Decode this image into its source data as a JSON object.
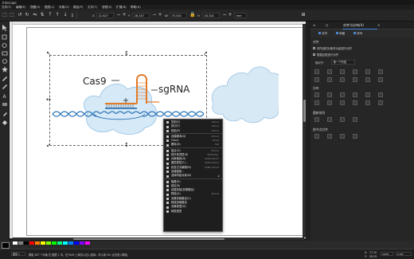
{
  "app": {
    "title": "Inkscape"
  },
  "menubar": [
    "文件(F)",
    "编辑(E)",
    "视图(V)",
    "图层(L)",
    "对象(O)",
    "路径(P)",
    "文字(T)",
    "滤镜(S)",
    "扩展(N)",
    "帮助(H)"
  ],
  "toolbar": {
    "x_label": "X",
    "x_value": "21.627",
    "y_label": "Y",
    "y_value": "26.337",
    "w_label": "W",
    "w_value": "75.001",
    "h_label": "H",
    "h_value": "43.301",
    "unit": "mm"
  },
  "drawing": {
    "cas9_label": "Cas9",
    "sgrna_label": "sgRNA"
  },
  "context_menu": [
    {
      "label": "复制(C)",
      "shortcut": "Ctrl+C"
    },
    {
      "label": "剪切(T)",
      "shortcut": "Ctrl+X"
    },
    {
      "label": "粘贴(P)",
      "shortcut": "Ctrl+V"
    },
    {
      "sep": true
    },
    {
      "label": "创建副本(D)",
      "shortcut": "Ctrl+D"
    },
    {
      "label": "Clone",
      "shortcut": "Alt+D"
    },
    {
      "label": "删除(D)",
      "shortcut": "Del"
    },
    {
      "sep": true
    },
    {
      "label": "组合(G)",
      "shortcut": "Ctrl+G"
    },
    {
      "label": "提升到顶层(R)",
      "shortcut": "Shift+Pg↑"
    },
    {
      "label": "对象裁剪(D)",
      "shortcut": "Shift+Ctrl+F"
    },
    {
      "label": "图层属性(F)...",
      "shortcut": "Shift+Ctrl+X"
    },
    {
      "label": "检查文字编辑(N)",
      "shortcut": "Shift+Ctrl+E"
    },
    {
      "label": "创建链接...",
      "shortcut": ""
    },
    {
      "label": "选择同组对象(M)",
      "shortcut": "",
      "submenu": true
    },
    {
      "sep": true
    },
    {
      "label": "隐藏(H)",
      "shortcut": ""
    },
    {
      "label": "锁定(K)",
      "shortcut": ""
    },
    {
      "label": "创建剪贴(剪辑路径)",
      "shortcut": ""
    },
    {
      "label": "群组(G)",
      "shortcut": "Ctrl+G"
    },
    {
      "label": "设置剪裁路径(C)",
      "shortcut": ""
    },
    {
      "label": "释放剪裁路径",
      "shortcut": ""
    },
    {
      "label": "设置遮罩(M)",
      "shortcut": ""
    },
    {
      "label": "释放遮罩",
      "shortcut": ""
    }
  ],
  "right_panel": {
    "tabs": [
      "对齐与分布(A)",
      "对象属性"
    ],
    "subtabs": [
      "对齐",
      "网格",
      "排列"
    ],
    "section_align": "对齐",
    "opt1": "将所选的对象作为组进行对齐",
    "opt2": "根据边框进行对齐",
    "relative_label": "相对于:",
    "relative_value": "第一个所选",
    "section_distribute": "分布",
    "section_remove_overlap": "重新排列",
    "section_nodes": "按节点对齐"
  },
  "status": {
    "message": "群组 287 个对象 在 图层 1 中。在 Shift 上单击以加入选择。可以用 Ctrl 点击进入群组。",
    "layer": "图层 1",
    "x": "77.10",
    "y": "28.29",
    "zoom": "100%",
    "rotation": "0.00°"
  },
  "palette": [
    "#ffffff",
    "#808080",
    "#000000",
    "#ff0000",
    "#ff8000",
    "#ffff00",
    "#80ff00",
    "#00ff00",
    "#00ff80",
    "#00ffff",
    "#0080ff",
    "#0000ff",
    "#8000ff",
    "#ff00ff"
  ]
}
